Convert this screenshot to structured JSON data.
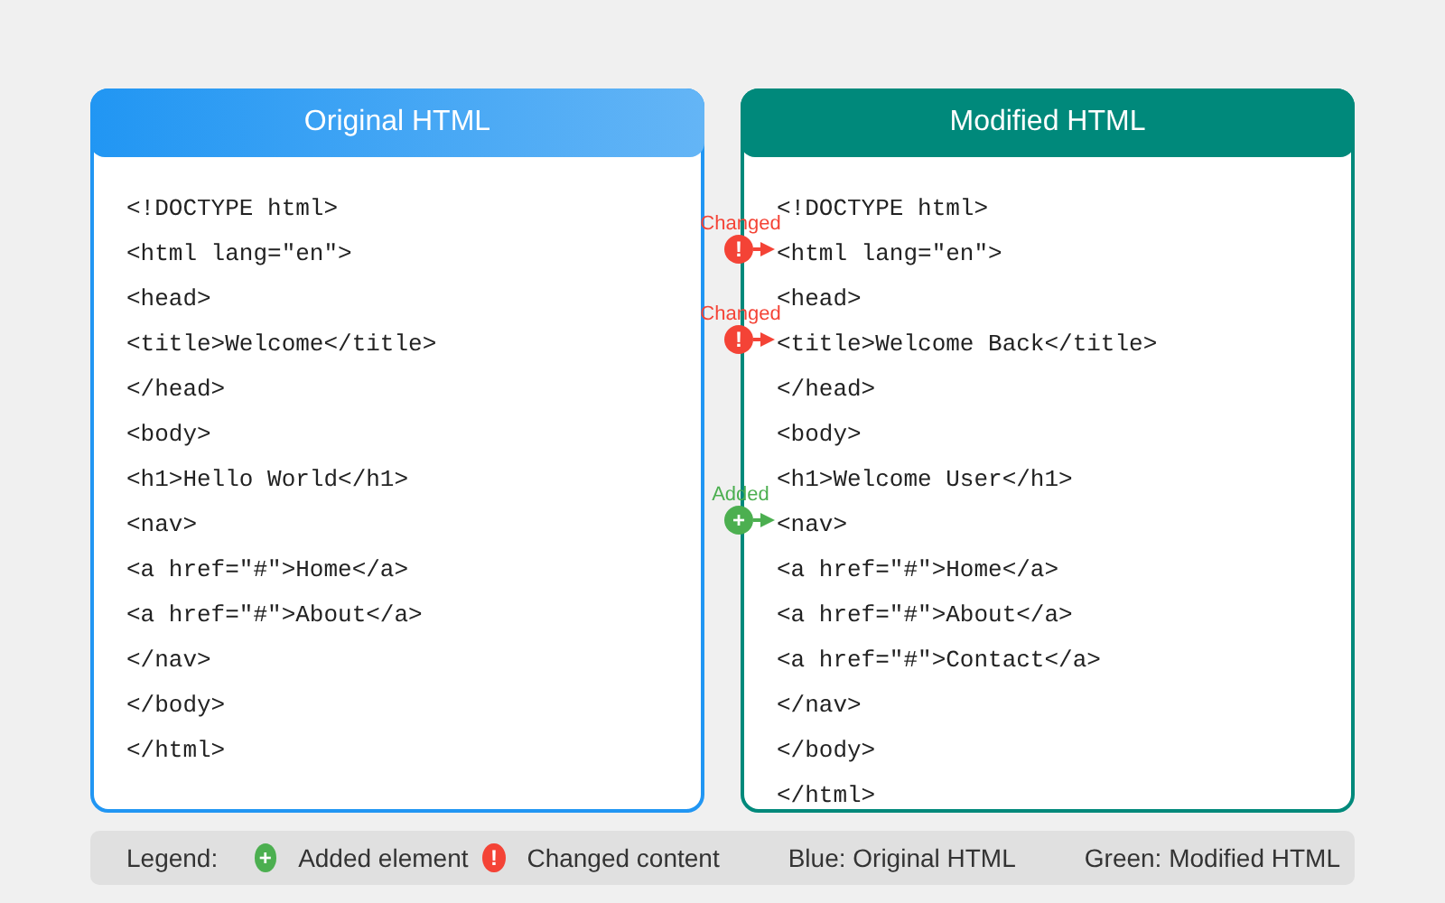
{
  "panels": [
    {
      "title": "Original HTML",
      "kind": "original",
      "lines": [
        {
          "text": "<!DOCTYPE html>"
        },
        {
          "text": "<html lang=\"en\">"
        },
        {
          "text": "<head>"
        },
        {
          "text": "<title>Welcome</title>"
        },
        {
          "text": "</head>"
        },
        {
          "text": "<body>"
        },
        {
          "text": "<h1>Hello World</h1>"
        },
        {
          "text": "<nav>"
        },
        {
          "text": "<a href=\"#\">Home</a>"
        },
        {
          "text": "<a href=\"#\">About</a>"
        },
        {
          "text": "</nav>"
        },
        {
          "text": "</body>"
        },
        {
          "text": "</html>"
        }
      ]
    },
    {
      "title": "Modified HTML",
      "kind": "modified",
      "lines": [
        {
          "text": "<!DOCTYPE html>"
        },
        {
          "text": "<html lang=\"en\">",
          "marker": {
            "kind": "changed",
            "label": "Changed",
            "symbol": "!"
          }
        },
        {
          "text": "<head>"
        },
        {
          "text": "<title>Welcome Back</title>",
          "marker": {
            "kind": "changed",
            "label": "Changed",
            "symbol": "!"
          }
        },
        {
          "text": "</head>"
        },
        {
          "text": "<body>"
        },
        {
          "text": "<h1>Welcome User</h1>"
        },
        {
          "text": "<nav>",
          "marker": {
            "kind": "added",
            "label": "Added",
            "symbol": "+"
          }
        },
        {
          "text": "<a href=\"#\">Home</a>"
        },
        {
          "text": "<a href=\"#\">About</a>"
        },
        {
          "text": "<a href=\"#\">Contact</a>"
        },
        {
          "text": "</nav>"
        },
        {
          "text": "</body>"
        },
        {
          "text": "</html>"
        }
      ]
    }
  ],
  "legend": {
    "title": "Legend:",
    "items": [
      {
        "kind": "added",
        "symbol": "+",
        "label": "Added element"
      },
      {
        "kind": "changed",
        "symbol": "!",
        "label": "Changed content"
      },
      {
        "kind": "text",
        "label": "Blue: Original HTML"
      },
      {
        "kind": "text",
        "label": "Green: Modified HTML"
      }
    ]
  }
}
